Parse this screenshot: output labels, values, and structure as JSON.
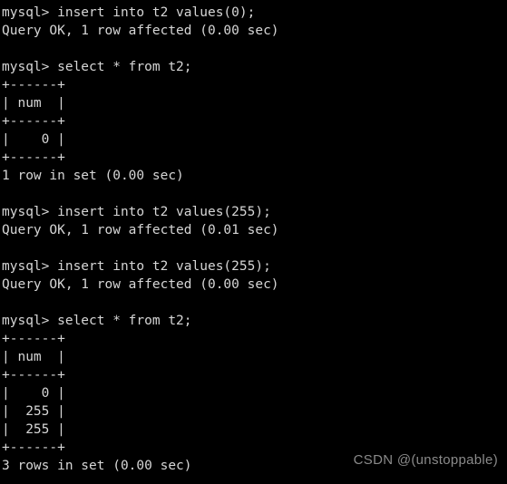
{
  "terminal": {
    "title": "mysql client session",
    "background_color": "#000000",
    "text_color": "#d6d6d6",
    "prompt": "mysql>",
    "lines": [
      "mysql> insert into t2 values(0);",
      "Query OK, 1 row affected (0.00 sec)",
      "",
      "mysql> select * from t2;",
      "+------+",
      "| num  |",
      "+------+",
      "|    0 |",
      "+------+",
      "1 row in set (0.00 sec)",
      "",
      "mysql> insert into t2 values(255);",
      "Query OK, 1 row affected (0.01 sec)",
      "",
      "mysql> insert into t2 values(255);",
      "Query OK, 1 row affected (0.00 sec)",
      "",
      "mysql> select * from t2;",
      "+------+",
      "| num  |",
      "+------+",
      "|    0 |",
      "|  255 |",
      "|  255 |",
      "+------+",
      "3 rows in set (0.00 sec)"
    ],
    "commands": [
      "insert into t2 values(0);",
      "select * from t2;",
      "insert into t2 values(255);",
      "insert into t2 values(255);",
      "select * from t2;"
    ],
    "results": [
      {
        "type": "status",
        "text": "Query OK, 1 row affected (0.00 sec)",
        "rows_affected": 1,
        "duration": "0.00 sec"
      },
      {
        "type": "table",
        "columns": [
          "num"
        ],
        "rows": [
          [
            "0"
          ]
        ],
        "footer": "1 row in set (0.00 sec)",
        "row_count": 1,
        "duration": "0.00 sec"
      },
      {
        "type": "status",
        "text": "Query OK, 1 row affected (0.01 sec)",
        "rows_affected": 1,
        "duration": "0.01 sec"
      },
      {
        "type": "status",
        "text": "Query OK, 1 row affected (0.00 sec)",
        "rows_affected": 1,
        "duration": "0.00 sec"
      },
      {
        "type": "table",
        "columns": [
          "num"
        ],
        "rows": [
          [
            "0"
          ],
          [
            "255"
          ],
          [
            "255"
          ]
        ],
        "footer": "3 rows in set (0.00 sec)",
        "row_count": 3,
        "duration": "0.00 sec"
      }
    ]
  },
  "watermark": {
    "text": "CSDN @(unstoppable)",
    "color": "#8a8a8a"
  }
}
